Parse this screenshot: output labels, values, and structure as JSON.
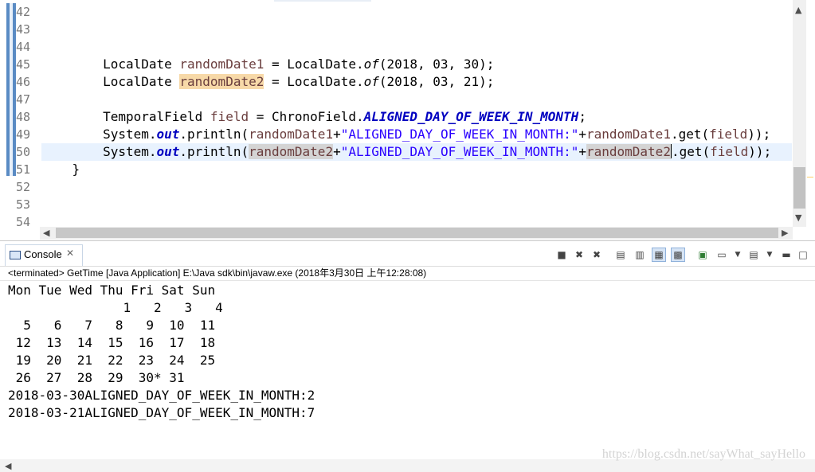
{
  "editor": {
    "line_numbers": [
      "42",
      "43",
      "44",
      "45",
      "46",
      "47",
      "48",
      "49",
      "50",
      "51",
      "52",
      "53",
      "54"
    ],
    "lines": {
      "l45": {
        "type": "LocalDate ",
        "var": "randomDate1",
        "mid": " = LocalDate.",
        "method": "of",
        "args": "(2018, 03, 30);"
      },
      "l46": {
        "type": "LocalDate ",
        "var": "randomDate2",
        "mid": " = LocalDate.",
        "method": "of",
        "args": "(2018, 03, 21);"
      },
      "l48": {
        "type": "TemporalField ",
        "var": "field",
        "mid": " = ChronoField.",
        "const": "ALIGNED_DAY_OF_WEEK_IN_MONTH",
        "end": ";"
      },
      "l49": {
        "pre": "System.",
        "out": "out",
        "call": ".println(",
        "var1": "randomDate1",
        "plus1": "+",
        "str": "\"ALIGNED_DAY_OF_WEEK_IN_MONTH:\"",
        "plus2": "+",
        "var2": "randomDate1",
        "get": ".get(",
        "arg": "field",
        "end": "));"
      },
      "l50": {
        "pre": "System.",
        "out": "out",
        "call": ".println(",
        "var1": "randomDate2",
        "plus1": "+",
        "str": "\"ALIGNED_DAY_OF_WEEK_IN_MONTH:\"",
        "plus2": "+",
        "var2": "randomDate2",
        "get": ".get(",
        "arg": "field",
        "end": "));"
      },
      "l51": {
        "text": "}"
      }
    }
  },
  "console": {
    "tab_label": "Console",
    "close_glyph": "✕",
    "status": "<terminated> GetTime [Java Application] E:\\Java sdk\\bin\\javaw.exe (2018年3月30日 上午12:28:08)",
    "output": [
      "Mon Tue Wed Thu Fri Sat Sun",
      "               1   2   3   4",
      "  5   6   7   8   9  10  11",
      " 12  13  14  15  16  17  18",
      " 19  20  21  22  23  24  25",
      " 26  27  28  29  30* 31",
      "2018-03-30ALIGNED_DAY_OF_WEEK_IN_MONTH:2",
      "2018-03-21ALIGNED_DAY_OF_WEEK_IN_MONTH:7"
    ],
    "toolbar_icons": [
      "terminate-icon",
      "remove-launch-icon",
      "remove-all-icon",
      "scroll-lock-icon",
      "word-wrap-icon",
      "show-on-output-icon",
      "show-on-error-icon",
      "pin-console-icon",
      "display-console-icon",
      "view-menu-icon",
      "minimize-icon",
      "maximize-icon"
    ]
  },
  "watermark": "https://blog.csdn.net/sayWhat_sayHello"
}
